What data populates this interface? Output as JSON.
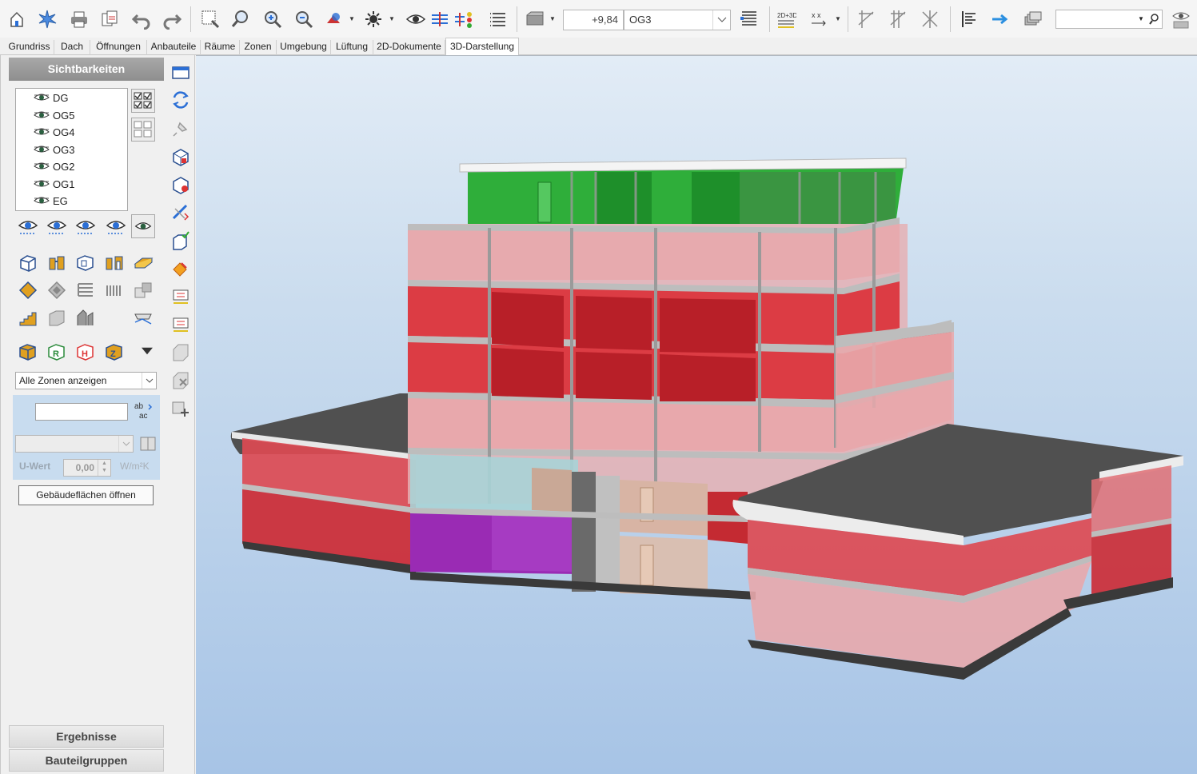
{
  "toolbar": {
    "height_value": "+9,84",
    "floor_value": "OG3",
    "search_placeholder": ""
  },
  "tabs": [
    {
      "label": "Grundriss"
    },
    {
      "label": "Dach"
    },
    {
      "label": "Öffnungen"
    },
    {
      "label": "Anbauteile"
    },
    {
      "label": "Räume"
    },
    {
      "label": "Zonen"
    },
    {
      "label": "Umgebung"
    },
    {
      "label": "Lüftung"
    },
    {
      "label": "2D-Dokumente"
    },
    {
      "label": "3D-Darstellung",
      "active": true
    }
  ],
  "left_panel": {
    "header": "Sichtbarkeiten",
    "floors": [
      "DG",
      "OG5",
      "OG4",
      "OG3",
      "OG2",
      "OG1",
      "EG"
    ],
    "zone_filter": "Alle Zonen anzeigen",
    "uwert_label": "U-Wert",
    "uwert_value": "0,00",
    "uwert_unit": "W/m²K",
    "open_button": "Gebäudeflächen öffnen",
    "results_label": "Ergebnisse",
    "groups_label": "Bauteilgruppen"
  },
  "colors": {
    "accent_blue": "#2b6fd6",
    "zone_green": "#2fae3a",
    "zone_red": "#dc3c44",
    "zone_pink": "#e8a8ac",
    "zone_purple": "#9a2bb4",
    "roof_gray": "#505050"
  }
}
